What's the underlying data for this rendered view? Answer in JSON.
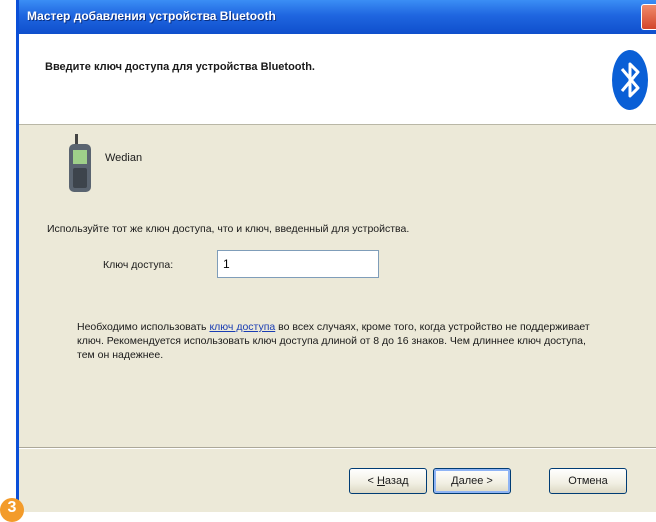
{
  "window": {
    "title": "Мастер добавления устройства Bluetooth"
  },
  "header": {
    "title": "Введите ключ доступа для устройства Bluetooth."
  },
  "device": {
    "name": "Wedian",
    "icon": "mobile-phone-icon"
  },
  "instruction": "Используйте тот же ключ доступа, что и ключ, введенный для устройства.",
  "passkey": {
    "label": "Ключ доступа:",
    "value": "1"
  },
  "note": {
    "before_link": "Необходимо использовать ",
    "link": "ключ доступа",
    "after_link": " во всех случаях, кроме того, когда устройство не поддерживает ключ. Рекомендуется использовать ключ доступа длиной от 8 до 16 знаков. Чем длиннее ключ доступа, тем он надежнее."
  },
  "buttons": {
    "back_mnemonic": "Н",
    "back_rest": "азад",
    "back_prefix": "< ",
    "next_mnemonic": "Д",
    "next_rest": "алее",
    "next_suffix": " >",
    "cancel": "Отмена"
  },
  "step_badge": "3",
  "colors": {
    "titlebar": "#1f66e0",
    "dialog_bg": "#ece9d8",
    "bluetooth_logo": "#0a5fd6",
    "step_badge": "#f39b2a"
  }
}
